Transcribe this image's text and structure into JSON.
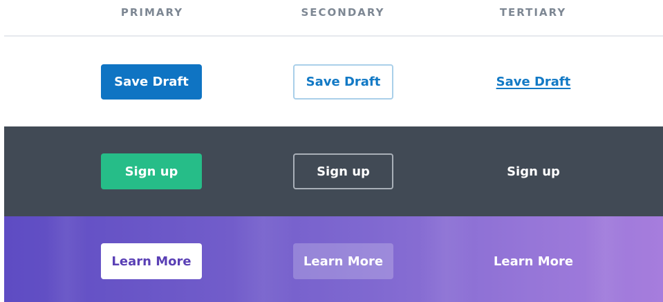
{
  "columns": {
    "primary": "PRIMARY",
    "secondary": "SECONDARY",
    "tertiary": "TERTIARY"
  },
  "rows": {
    "light": {
      "primary_label": "Save Draft",
      "secondary_label": "Save Draft",
      "tertiary_label": "Save Draft"
    },
    "dark": {
      "primary_label": "Sign up",
      "secondary_label": "Sign up",
      "tertiary_label": "Sign up"
    },
    "purple": {
      "primary_label": "Learn More",
      "secondary_label": "Learn More",
      "tertiary_label": "Learn More"
    }
  },
  "colors": {
    "header_text": "#7d8793",
    "blue_accent": "#0f74c3",
    "green_accent": "#26bd88",
    "dark_background": "#414a55",
    "purple_gradient_start": "#5e4cc3",
    "purple_gradient_end": "#a67ddd"
  }
}
